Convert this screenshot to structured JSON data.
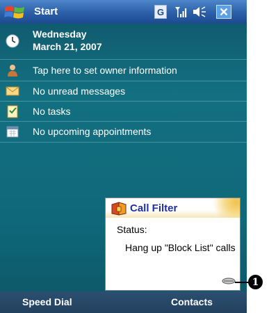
{
  "titlebar": {
    "start_label": "Start",
    "g_icon_label": "G"
  },
  "today": {
    "weekday": "Wednesday",
    "date": "March 21, 2007",
    "owner": "Tap here to set owner information",
    "messages": "No unread messages",
    "tasks": "No tasks",
    "appointments": "No upcoming appointments"
  },
  "notification": {
    "title": "Call Filter",
    "status_label": "Status:",
    "body": "Hang up \"Block List\" calls"
  },
  "softkeys": {
    "left": "Speed Dial",
    "right": "Contacts"
  },
  "callout": {
    "marker": "1"
  },
  "colors": {
    "title_bar": "#2b5fa8",
    "today_background": "#137080",
    "notification_title": "#1f2fa0",
    "softkey_bar": "#22415f"
  },
  "icons": [
    "windows-start-icon",
    "g-icon",
    "signal-icon",
    "volume-icon",
    "close-icon",
    "clock-icon",
    "owner-icon",
    "envelope-icon",
    "tasks-icon",
    "calendar-icon",
    "call-filter-icon",
    "grip-icon"
  ]
}
